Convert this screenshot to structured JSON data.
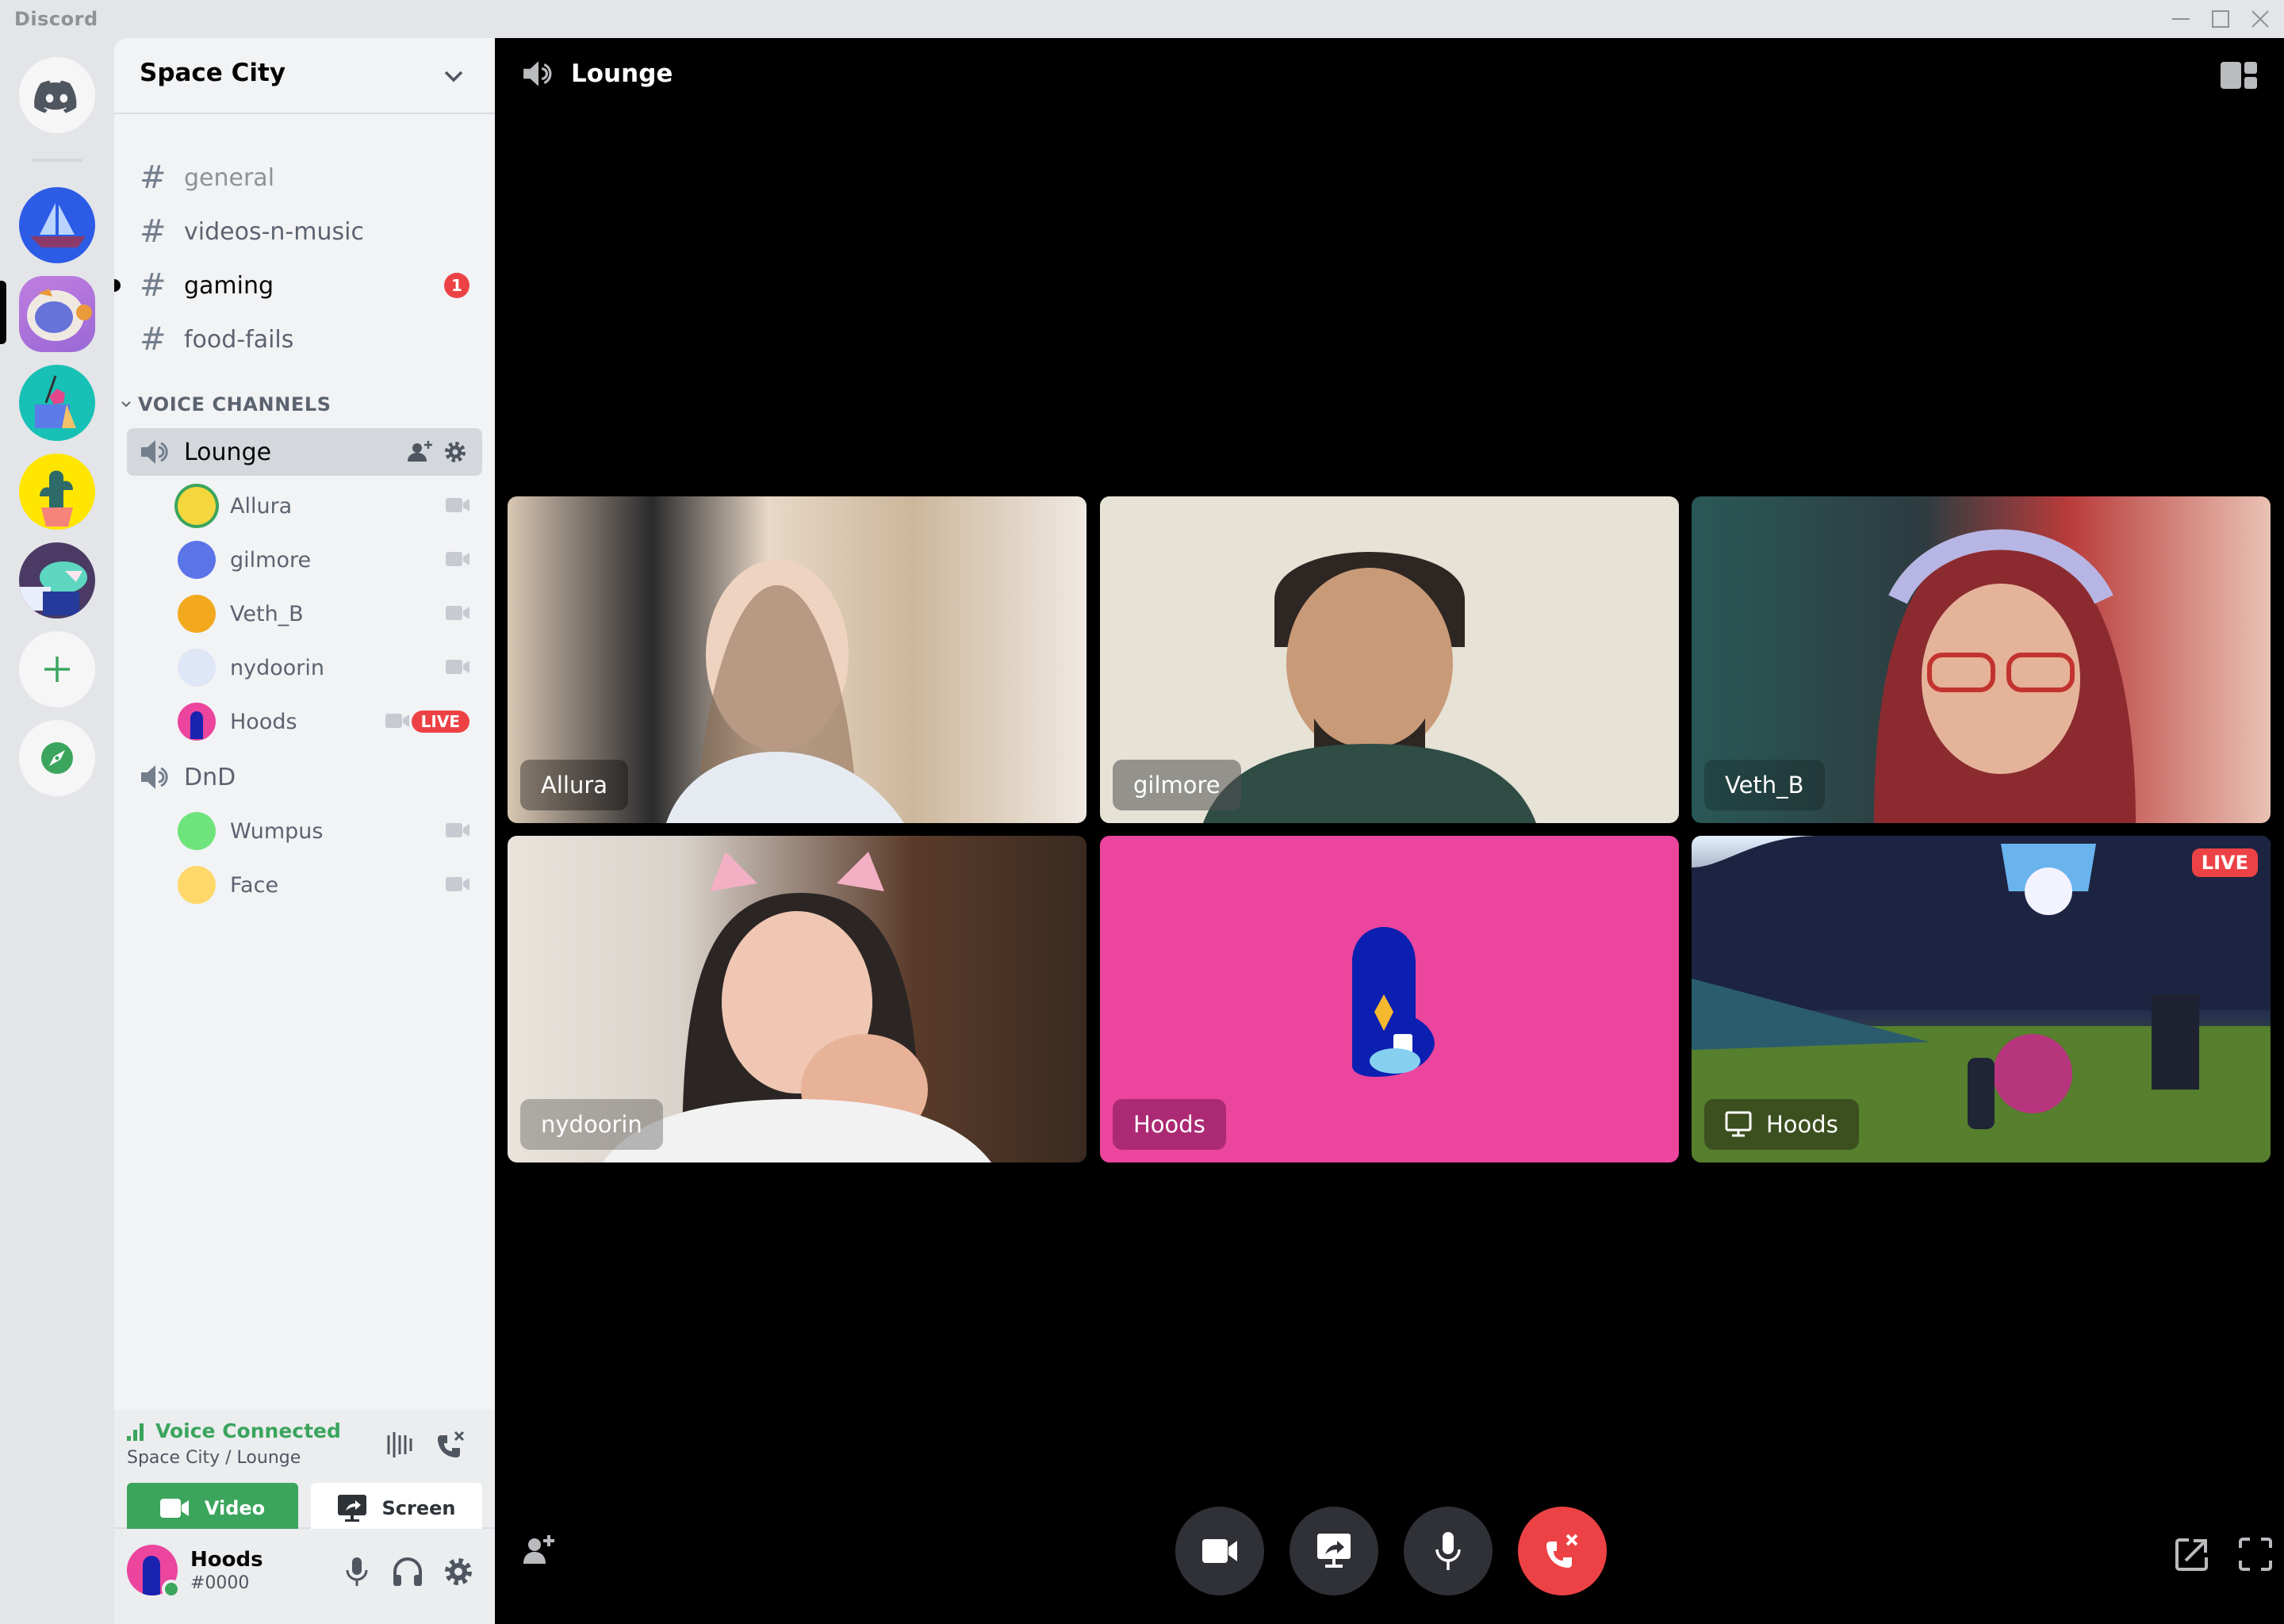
{
  "window": {
    "app_name": "Discord",
    "controls": [
      "minimize-icon",
      "maximize-icon",
      "close-icon"
    ]
  },
  "server_rail": {
    "home_icon": "discord-logo-icon",
    "servers": [
      {
        "name": "ship-server",
        "color": "#2c5ce6"
      },
      {
        "name": "Space City",
        "color": "#c07ee0",
        "active": true
      },
      {
        "name": "dnd-server",
        "color": "#17c1b5"
      },
      {
        "name": "cactus-server",
        "color": "#ffe600"
      },
      {
        "name": "fish-server",
        "color": "#4a3a64"
      }
    ],
    "add_server_icon": "plus-icon",
    "explore_icon": "compass-icon",
    "accent": "#3ba55d"
  },
  "sidebar": {
    "server_name": "Space City",
    "text_channels": [
      {
        "name": "general",
        "state": "muted"
      },
      {
        "name": "videos-n-music",
        "state": "normal"
      },
      {
        "name": "gaming",
        "state": "unread",
        "mentions": "1"
      },
      {
        "name": "food-fails",
        "state": "normal"
      }
    ],
    "voice_category": "VOICE CHANNELS",
    "voice_channels": [
      {
        "name": "Lounge",
        "selected": true,
        "members": [
          {
            "name": "Allura",
            "speaking": true,
            "video": true,
            "avatar_color": "#f5d63d"
          },
          {
            "name": "gilmore",
            "video": true,
            "avatar_color": "#5b74e8"
          },
          {
            "name": "Veth_B",
            "video": true,
            "avatar_color": "#f3a91e"
          },
          {
            "name": "nydoorin",
            "video": true,
            "avatar_color": "#dfe6f5"
          },
          {
            "name": "Hoods",
            "video": true,
            "live": true,
            "avatar_color": "#eb459e"
          }
        ]
      },
      {
        "name": "DnD",
        "selected": false,
        "members": [
          {
            "name": "Wumpus",
            "video": true,
            "avatar_color": "#6fe47d"
          },
          {
            "name": "Face",
            "video": true,
            "avatar_color": "#ffd86b"
          }
        ]
      }
    ],
    "live_label": "LIVE"
  },
  "voice_panel": {
    "status": "Voice Connected",
    "location": "Space City / Lounge",
    "video_label": "Video",
    "screen_label": "Screen",
    "status_color": "#3ba55d"
  },
  "user_panel": {
    "username": "Hoods",
    "tag": "#0000",
    "status": "online"
  },
  "main": {
    "channel_title": "Lounge",
    "tiles": [
      {
        "name": "Allura",
        "type": "camera",
        "bg": [
          "#d9c7b3",
          "#2b2a2c"
        ]
      },
      {
        "name": "gilmore",
        "type": "camera",
        "bg": [
          "#e6e2d6",
          "#2f4c45"
        ]
      },
      {
        "name": "Veth_B",
        "type": "camera",
        "bg": [
          "#2a5856",
          "#b93b3b"
        ]
      },
      {
        "name": "nydoorin",
        "type": "camera",
        "bg": [
          "#e9e4dc",
          "#5a3b2a"
        ]
      },
      {
        "name": "Hoods",
        "type": "avatar",
        "bg": [
          "#eb459e",
          "#eb459e"
        ]
      },
      {
        "name": "Hoods",
        "type": "stream",
        "live": true,
        "bg": [
          "#d9ecff",
          "#4b7a2a"
        ]
      }
    ],
    "live_label": "LIVE",
    "controls": [
      {
        "name": "camera",
        "icon": "video-camera-icon"
      },
      {
        "name": "screen-share",
        "icon": "screen-share-icon"
      },
      {
        "name": "microphone",
        "icon": "microphone-icon"
      },
      {
        "name": "disconnect",
        "icon": "hang-up-icon"
      }
    ]
  }
}
